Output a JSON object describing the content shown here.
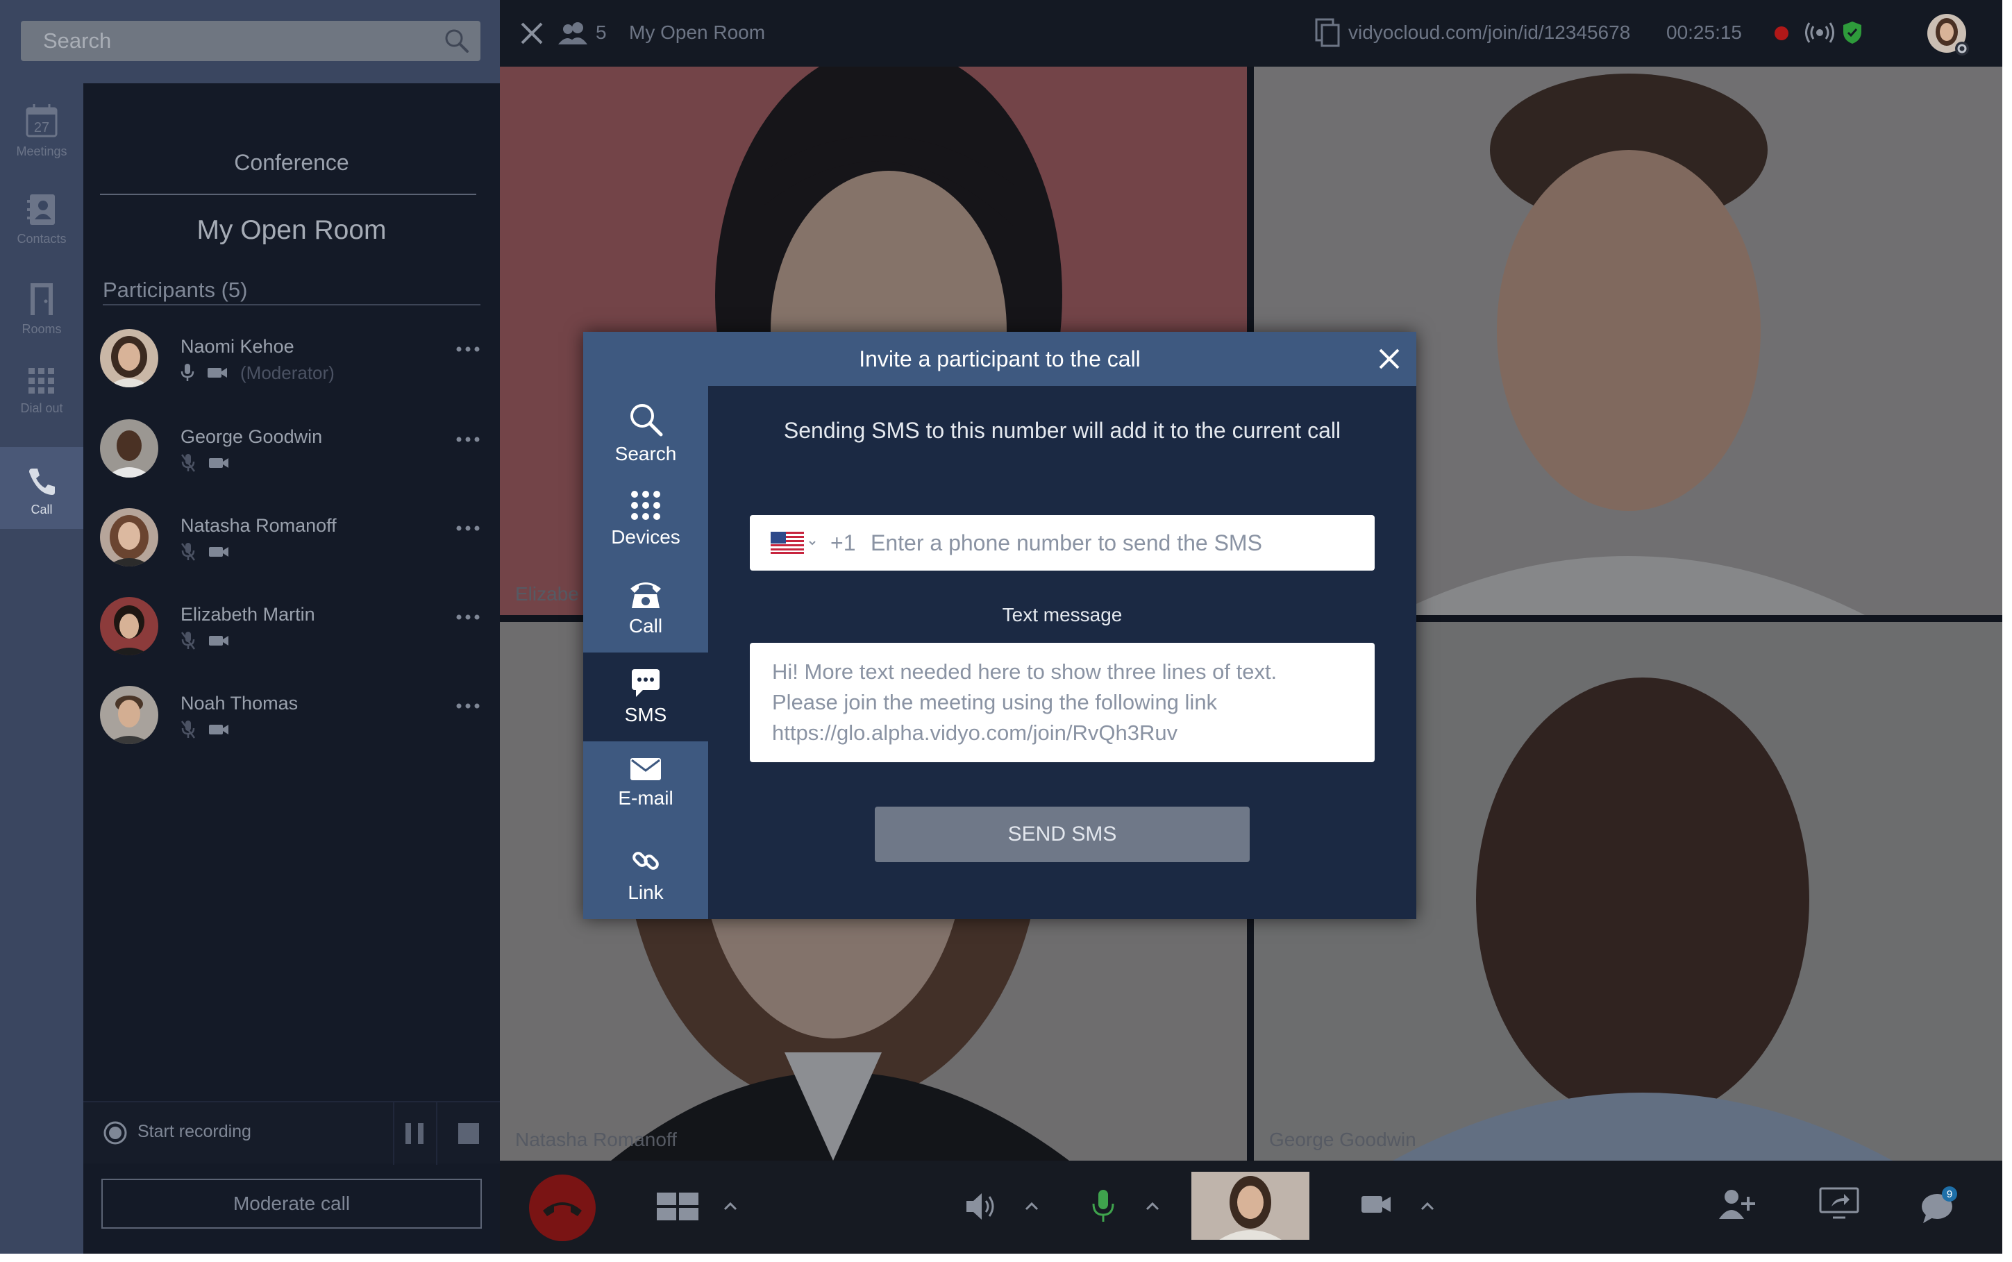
{
  "search": {
    "placeholder": "Search"
  },
  "rail": {
    "items": [
      {
        "label": "Meetings",
        "day": "27",
        "icon": "calendar-icon"
      },
      {
        "label": "Contacts",
        "icon": "contacts-icon"
      },
      {
        "label": "Rooms",
        "icon": "door-icon"
      },
      {
        "label": "Dial out",
        "icon": "dialpad-icon"
      },
      {
        "label": "Call",
        "icon": "phone-icon",
        "active": true
      }
    ]
  },
  "panel": {
    "title": "Conference",
    "room_name": "My Open Room",
    "participants_header": "Participants (5)",
    "participants": [
      {
        "name": "Naomi Kehoe",
        "role": "(Moderator)",
        "mic": "on",
        "camera": "on"
      },
      {
        "name": "George Goodwin",
        "mic": "muted",
        "camera": "on"
      },
      {
        "name": "Natasha Romanoff",
        "mic": "muted",
        "camera": "on"
      },
      {
        "name": "Elizabeth Martin",
        "mic": "muted",
        "camera": "on"
      },
      {
        "name": "Noah Thomas",
        "mic": "muted",
        "camera": "on"
      }
    ],
    "recording_label": "Start recording",
    "moderate_label": "Moderate call"
  },
  "topbar": {
    "participant_count": "5",
    "room_name": "My Open Room",
    "link": "vidyocloud.com/join/id/12345678",
    "timer": "00:25:15"
  },
  "tiles": [
    {
      "name": "Elizabeth Martin",
      "visible_name": "Elizabe"
    },
    {
      "name": ""
    },
    {
      "name": "Natasha Romanoff"
    },
    {
      "name": "George Goodwin"
    }
  ],
  "bottombar": {
    "chat_badge": "9"
  },
  "modal": {
    "title": "Invite a participant to the call",
    "nav": [
      {
        "label": "Search",
        "icon": "search-icon"
      },
      {
        "label": "Devices",
        "icon": "devices-grid-icon"
      },
      {
        "label": "Call",
        "icon": "phone-call-icon"
      },
      {
        "label": "SMS",
        "icon": "sms-bubble-icon",
        "active": true
      },
      {
        "label": "E-mail",
        "icon": "envelope-icon"
      },
      {
        "label": "Link",
        "icon": "link-icon"
      }
    ],
    "info": "Sending SMS to this number will add it to the current call",
    "phone": {
      "country_code": "+1",
      "placeholder": "Enter a phone number to send the SMS"
    },
    "message_label": "Text message",
    "message_placeholder_lines": [
      "Hi! More text needed here to show three lines of text.",
      "Please join the meeting using the following link",
      "https://glo.alpha.vidyo.com/join/RvQh3Ruv"
    ],
    "send_label": "SEND SMS"
  },
  "colors": {
    "modal_header": "#3e5980",
    "modal_body": "#1b2943",
    "panel_bg": "#141a27",
    "rail_bg": "#3a4660",
    "hangup_red": "#7a1414",
    "mic_green": "#3fa34d",
    "shield_green": "#2e9b3b",
    "record_red": "#b01818",
    "send_button": "#6f7888"
  }
}
